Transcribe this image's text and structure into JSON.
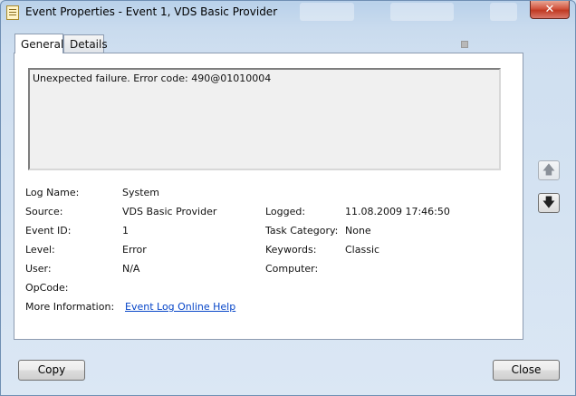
{
  "window": {
    "title": "Event Properties - Event 1, VDS Basic Provider",
    "close_glyph": "✕"
  },
  "tabs": [
    {
      "label": "General",
      "active": true
    },
    {
      "label": "Details",
      "active": false
    }
  ],
  "message": "Unexpected failure. Error code: 490@01010004",
  "fields_left": {
    "log_name": {
      "label": "Log Name:",
      "value": "System"
    },
    "source": {
      "label": "Source:",
      "value": "VDS Basic Provider"
    },
    "event_id": {
      "label": "Event ID:",
      "value": "1"
    },
    "level": {
      "label": "Level:",
      "value": "Error"
    },
    "user": {
      "label": "User:",
      "value": "N/A"
    },
    "opcode": {
      "label": "OpCode:",
      "value": ""
    },
    "more_info": {
      "label": "More Information:",
      "link": "Event Log Online Help"
    }
  },
  "fields_right": {
    "logged": {
      "label": "Logged:",
      "value": "11.08.2009 17:46:50"
    },
    "task_category": {
      "label": "Task Category:",
      "value": "None"
    },
    "keywords": {
      "label": "Keywords:",
      "value": "Classic"
    },
    "computer": {
      "label": "Computer:",
      "value": ""
    }
  },
  "nav": {
    "up_icon": "arrow-up-icon",
    "down_icon": "arrow-down-icon",
    "up_glyph": "🡅",
    "down_glyph": "🡇"
  },
  "buttons": {
    "copy": "Copy",
    "close": "Close"
  },
  "colors": {
    "link": "#0645c8",
    "close_button": "#c03a22"
  }
}
